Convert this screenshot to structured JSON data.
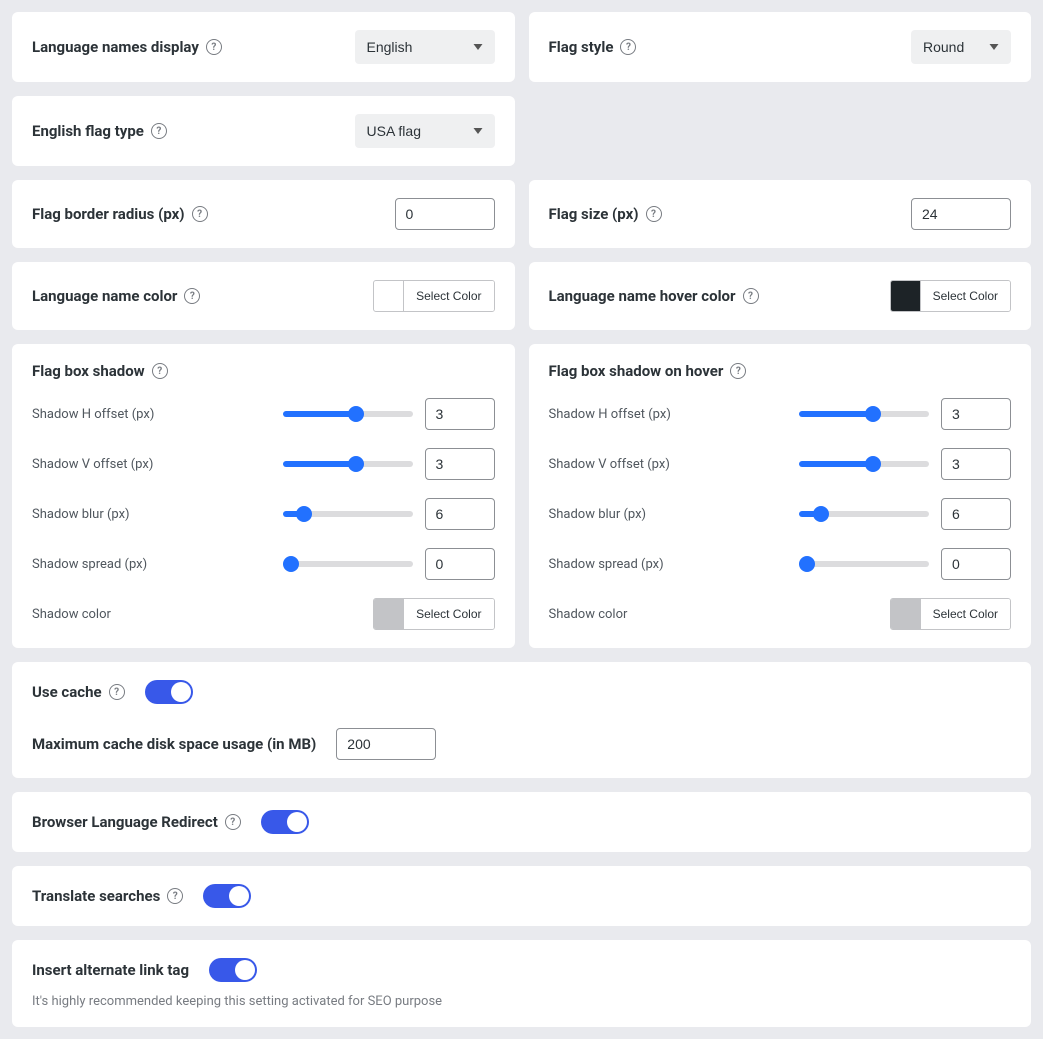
{
  "common": {
    "select_color": "Select Color",
    "help_glyph": "?"
  },
  "row1": {
    "left": {
      "label": "Language names display",
      "value": "English"
    },
    "right": {
      "label": "Flag style",
      "value": "Round"
    }
  },
  "row2": {
    "left": {
      "label": "English flag type",
      "value": "USA flag"
    }
  },
  "row3": {
    "left": {
      "label": "Flag border radius (px)",
      "value": "0"
    },
    "right": {
      "label": "Flag size (px)",
      "value": "24"
    }
  },
  "row4": {
    "left": {
      "label": "Language name color",
      "swatch": "#1d2327"
    },
    "right": {
      "label": "Language name hover color",
      "swatch": "#1d2327"
    }
  },
  "shadow": {
    "left": {
      "title": "Flag box shadow",
      "h_label": "Shadow H offset (px)",
      "h_val": "3",
      "v_label": "Shadow V offset (px)",
      "v_val": "3",
      "blur_label": "Shadow blur (px)",
      "blur_val": "6",
      "spread_label": "Shadow spread (px)",
      "spread_val": "0",
      "color_label": "Shadow color",
      "swatch": "#c3c4c7"
    },
    "right": {
      "title": "Flag box shadow on hover",
      "h_label": "Shadow H offset (px)",
      "h_val": "3",
      "v_label": "Shadow V offset (px)",
      "v_val": "3",
      "blur_label": "Shadow blur (px)",
      "blur_val": "6",
      "spread_label": "Shadow spread (px)",
      "spread_val": "0",
      "color_label": "Shadow color",
      "swatch": "#c3c4c7"
    }
  },
  "cache": {
    "use_label": "Use cache",
    "max_label": "Maximum cache disk space usage (in MB)",
    "max_value": "200"
  },
  "redirect": {
    "label": "Browser Language Redirect"
  },
  "searches": {
    "label": "Translate searches"
  },
  "altlink": {
    "label": "Insert alternate link tag",
    "hint": "It's highly recommended keeping this setting activated for SEO purpose"
  }
}
